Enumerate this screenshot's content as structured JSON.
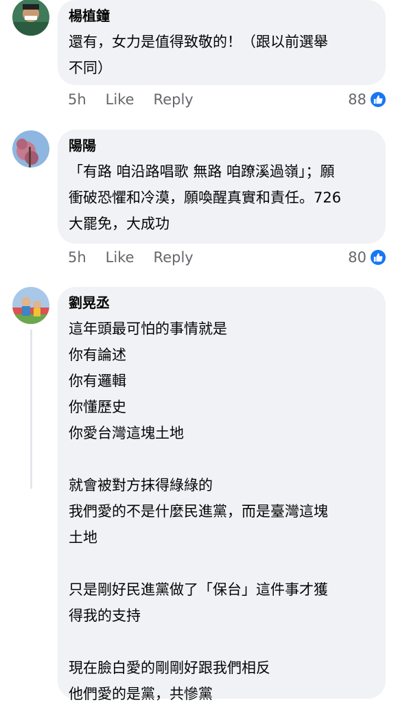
{
  "comments": [
    {
      "author": "楊植鐘",
      "text": "還有，女力是值得致敬的！（跟以前選舉\n不同）",
      "time": "5h",
      "like_label": "Like",
      "reply_label": "Reply",
      "reaction_count": "88"
    },
    {
      "author": "陽陽",
      "text": "「有路 咱沿路唱歌 無路 咱蹽溪過嶺」；願\n衝破恐懼和冷漠，願喚醒真實和責任。726\n大罷免，大成功",
      "time": "5h",
      "like_label": "Like",
      "reply_label": "Reply",
      "reaction_count": "80"
    },
    {
      "author": "劉晃丞",
      "text": "這年頭最可怕的事情就是\n你有論述\n你有邏輯\n你懂歷史\n你愛台灣這塊土地\n\n就會被對方抹得綠綠的\n我們愛的不是什麼民進黨，而是臺灣這塊\n土地\n\n只是剛好民進黨做了「保台」這件事才獲\n得我的支持\n\n現在臉白愛的剛剛好跟我們相反\n他們愛的是黨，共慘黨"
    }
  ],
  "colors": {
    "bubble": "#f0f2f5",
    "meta": "#65676b",
    "like_blue": "#1877f2"
  }
}
